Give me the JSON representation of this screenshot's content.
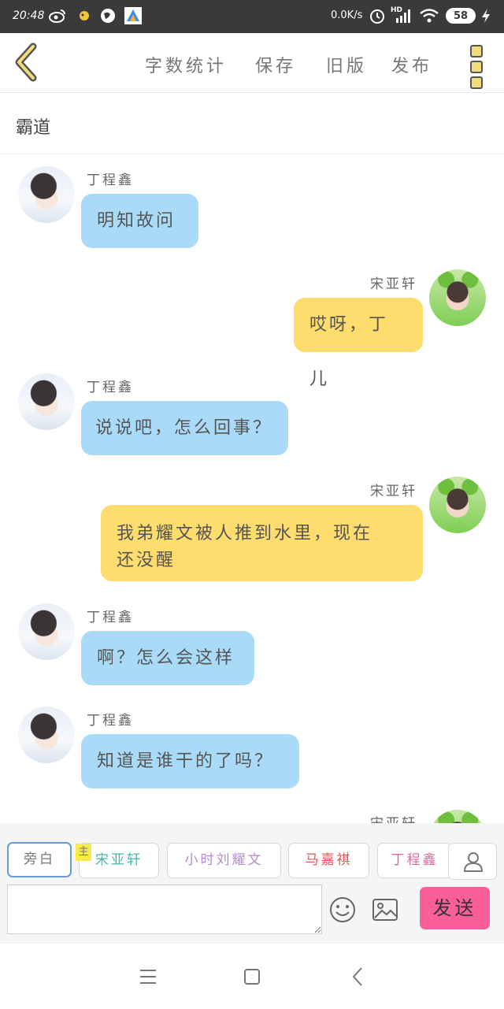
{
  "status_bar": {
    "time": "20:48",
    "net_speed": "0.0K/s",
    "network_label": "HD",
    "battery": "58"
  },
  "toolbar": {
    "word_count": "字数统计",
    "save": "保存",
    "old_version": "旧版",
    "publish": "发布"
  },
  "story_title": "霸道",
  "messages": [
    {
      "sender": "丁程鑫",
      "text": "明知故问"
    },
    {
      "sender": "宋亚轩",
      "text": "哎呀，丁儿"
    },
    {
      "sender": "丁程鑫",
      "text": "说说吧，怎么回事？"
    },
    {
      "sender": "宋亚轩",
      "text_line1": "我弟耀文被人推到水里，现在",
      "text_line2": "还没醒"
    },
    {
      "sender": "丁程鑫",
      "text": "啊？怎么会这样"
    },
    {
      "sender": "丁程鑫",
      "text": "知道是谁干的了吗？"
    },
    {
      "sender": "宋亚轩"
    }
  ],
  "roles": {
    "narrator": "旁白",
    "main_badge": "主",
    "song": "宋亚轩",
    "liu": "小时刘耀文",
    "ma": "马嘉祺",
    "ding": "丁程鑫"
  },
  "colors": {
    "blue_bubble": "#a9dbf8",
    "yellow_bubble": "#fedc6e",
    "send_button": "#fb5f9a",
    "role_song": "#3fb8a8",
    "role_liu": "#b58ad0",
    "role_ma": "#e0574f",
    "role_ding": "#e06aa0"
  },
  "composer": {
    "send_label": "发送"
  }
}
